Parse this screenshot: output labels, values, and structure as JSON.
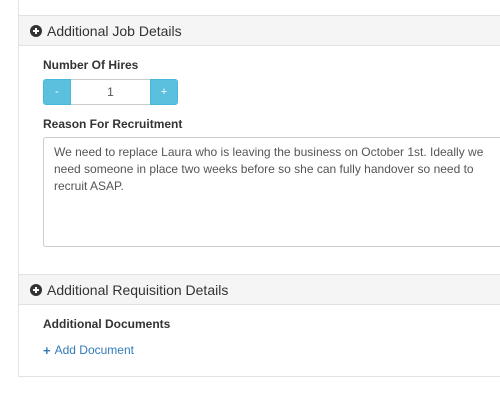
{
  "job_details": {
    "title": "Additional Job Details",
    "number_of_hires": {
      "label": "Number Of Hires",
      "minus_label": "-",
      "value": "1",
      "plus_label": "+"
    },
    "reason": {
      "label": "Reason For Recruitment",
      "value": "We need to replace Laura who is leaving the business on October 1st. Ideally we need someone in place two weeks before so she can fully handover so need to recruit ASAP."
    }
  },
  "requisition_details": {
    "title": "Additional Requisition Details",
    "documents": {
      "label": "Additional Documents",
      "add_label": "Add Document",
      "add_icon": "+"
    }
  },
  "colors": {
    "stepper_button": "#5bc0de",
    "link": "#337ab7",
    "section_header_bg": "#f5f5f5"
  }
}
